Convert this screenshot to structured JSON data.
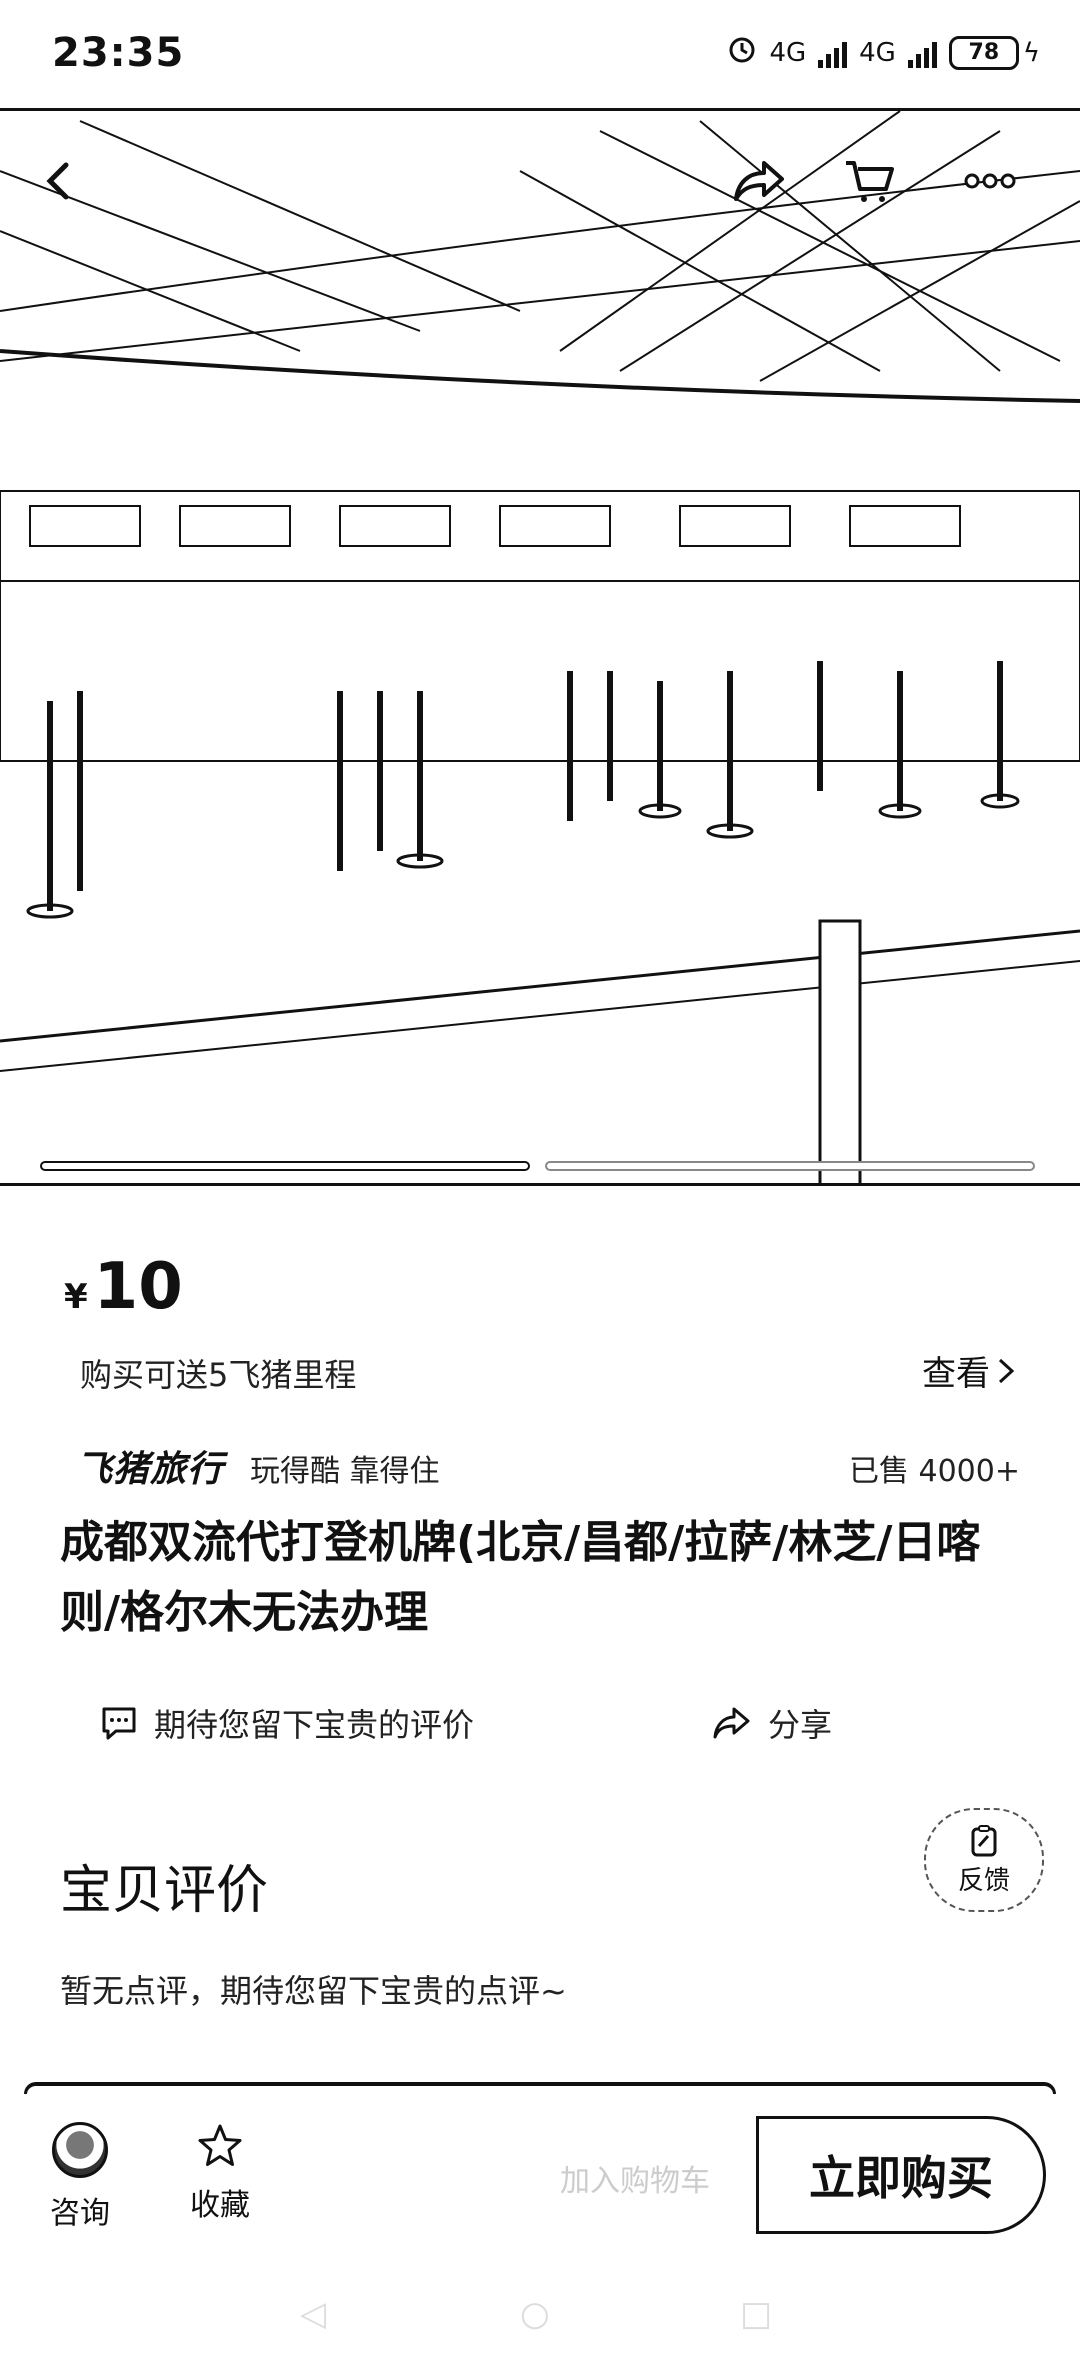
{
  "status_bar": {
    "time": "23:35",
    "network": "4G",
    "battery": "78"
  },
  "hero": {
    "image_alt": "Airport check-in hall",
    "carousel_position": 0.5,
    "icons": [
      "back-arrow-icon",
      "share-icon",
      "cart-icon",
      "more-icon"
    ]
  },
  "product": {
    "currency": "¥",
    "price": "10",
    "miles_text": "购买可送5飞猪里程",
    "view_label": "查看",
    "brand": "飞猪旅行",
    "slogan": "玩得酷 靠得住",
    "sold": "已售 4000+",
    "title": "成都双流代打登机牌(北京/昌都/拉萨/林芝/日喀则/格尔木无法办理"
  },
  "actions": {
    "review_prompt": "期待您留下宝贵的评价",
    "share": "分享"
  },
  "reviews": {
    "section_title": "宝贝评价",
    "feedback_label": "反馈",
    "empty_text": "暂无点评，期待您留下宝贵的点评~"
  },
  "bottom_bar": {
    "consult": "咨询",
    "favorite": "收藏",
    "ghost_text": "加入购物车",
    "buy": "立即购买"
  },
  "colors": {
    "foreground": "#111111",
    "background": "#ffffff"
  }
}
